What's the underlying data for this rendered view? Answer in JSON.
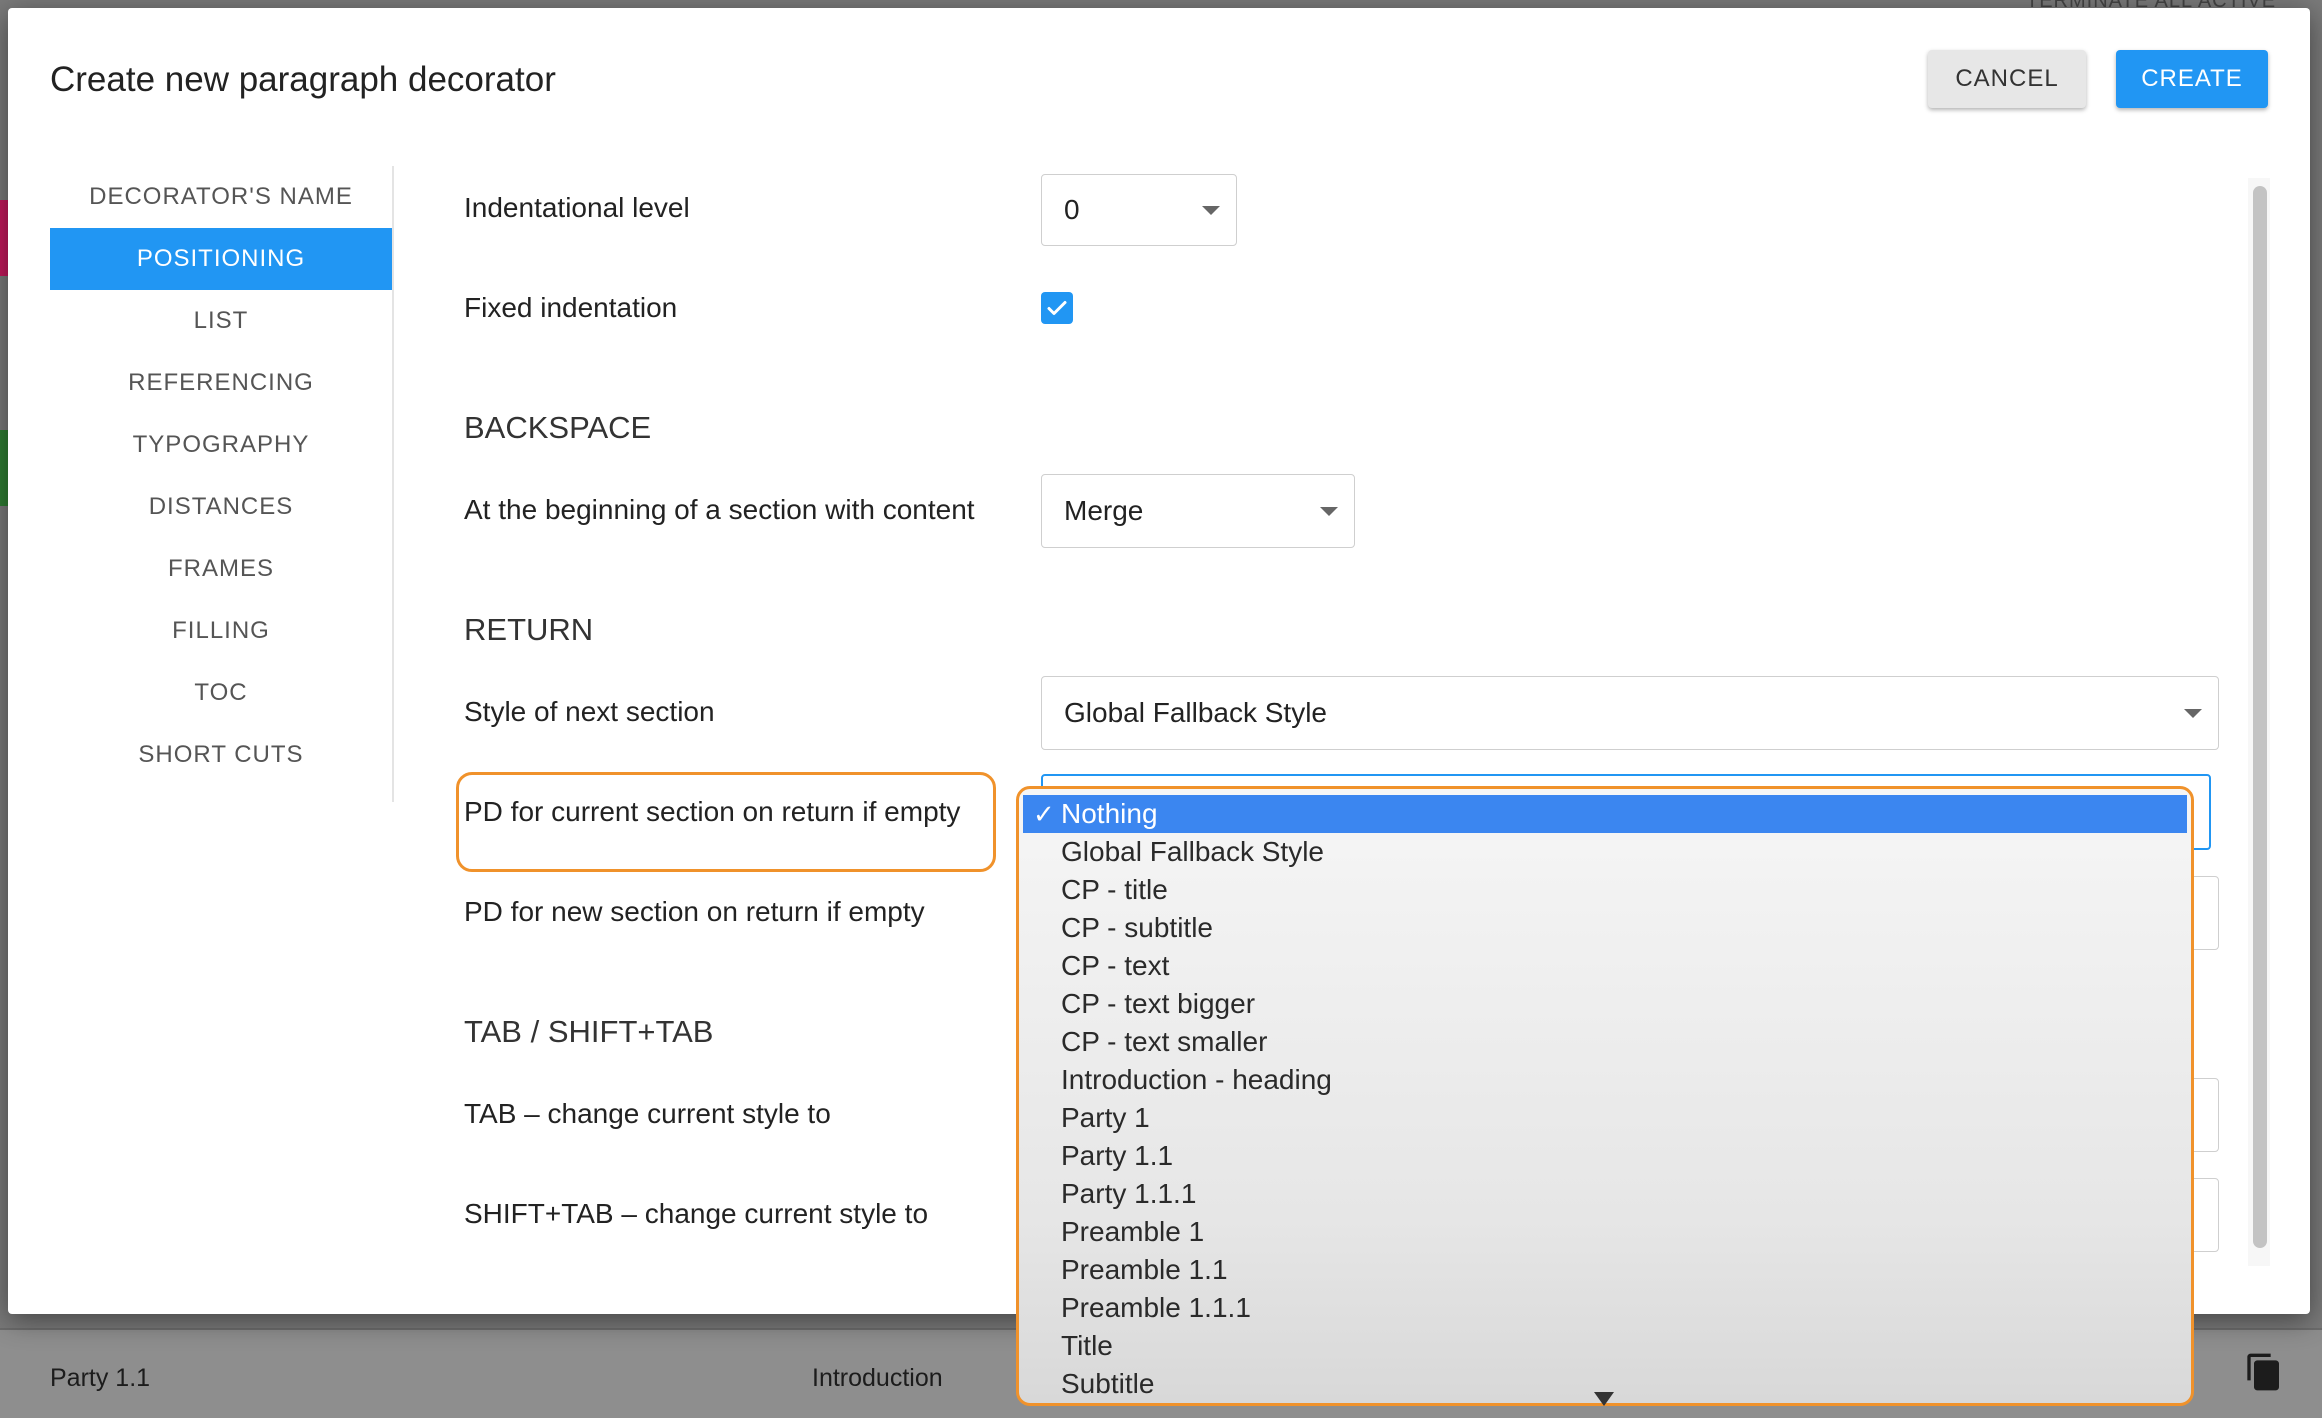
{
  "background": {
    "top_right_text": "TERMINATE ALL ACTIVE SESSI",
    "bottom_left_text": "Party 1.1",
    "bottom_mid_text": "Introduction",
    "copy_icon": "copy-icon",
    "accent_chip_colors": [
      "#c2185b",
      "#2e7d32"
    ]
  },
  "dialog": {
    "title": "Create new paragraph decorator",
    "cancel_label": "CANCEL",
    "create_label": "CREATE"
  },
  "sidebar": {
    "items": [
      {
        "label": "DECORATOR'S NAME",
        "active": false
      },
      {
        "label": "POSITIONING",
        "active": true
      },
      {
        "label": "LIST",
        "active": false
      },
      {
        "label": "REFERENCING",
        "active": false
      },
      {
        "label": "TYPOGRAPHY",
        "active": false
      },
      {
        "label": "DISTANCES",
        "active": false
      },
      {
        "label": "FRAMES",
        "active": false
      },
      {
        "label": "FILLING",
        "active": false
      },
      {
        "label": "TOC",
        "active": false
      },
      {
        "label": "SHORT CUTS",
        "active": false
      }
    ]
  },
  "form": {
    "indentational_level": {
      "label": "Indentational level",
      "value": "0"
    },
    "fixed_indentation": {
      "label": "Fixed indentation",
      "checked": true
    },
    "backspace": {
      "heading": "BACKSPACE",
      "beginning_label": "At the beginning of a section with content",
      "beginning_value": "Merge"
    },
    "return": {
      "heading": "RETURN",
      "next_style_label": "Style of next section",
      "next_style_value": "Global Fallback Style",
      "current_empty_label": "PD for current section on return if empty",
      "new_empty_label": "PD for new section on return if empty"
    },
    "tab": {
      "heading": "TAB / SHIFT+TAB",
      "tab_label": "TAB – change current style to",
      "shift_tab_label": "SHIFT+TAB – change current style to"
    }
  },
  "dropdown": {
    "selected_check": "✓",
    "options": [
      "Nothing",
      "Global Fallback Style",
      "CP - title",
      "CP - subtitle",
      "CP - text",
      "CP - text bigger",
      "CP - text smaller",
      "Introduction - heading",
      "Party 1",
      "Party 1.1",
      "Party 1.1.1",
      "Preamble 1",
      "Preamble 1.1",
      "Preamble 1.1.1",
      "Title",
      "Subtitle"
    ],
    "selected_index": 0
  },
  "colors": {
    "accent": "#2196f3",
    "highlight_outline": "#f0922b",
    "selected_option": "#3b86f0"
  }
}
